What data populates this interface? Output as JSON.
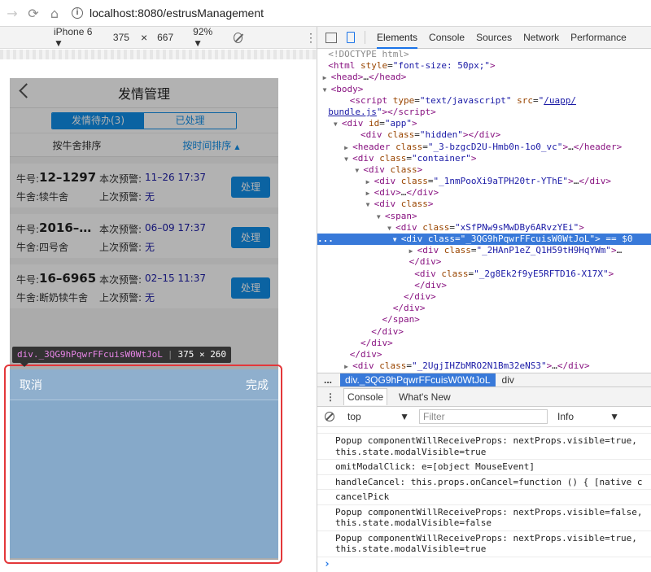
{
  "browser": {
    "url": "localhost:8080/estrusManagement"
  },
  "device_toolbar": {
    "device": "iPhone 6 ▼",
    "width": "375",
    "times": "×",
    "height": "667",
    "zoom": "92% ▼"
  },
  "app": {
    "title": "发情管理",
    "tabs": [
      "发情待办(3)",
      "已处理"
    ],
    "sort_by_shed": "按牛舍排序",
    "sort_by_time": "按时间排序",
    "sort_arrow": "▲",
    "cards": [
      {
        "cow_label": "牛号:",
        "cow_no": "12–1297",
        "shed_label": "牛舍:",
        "shed": "犊牛舍",
        "this_label": "本次预警:",
        "this_time": "11–26 17:37",
        "last_label": "上次预警:",
        "last_time": "无",
        "action": "处理"
      },
      {
        "cow_label": "牛号:",
        "cow_no": "2016–1…",
        "shed_label": "牛舍:",
        "shed": "四号舍",
        "this_label": "本次预警:",
        "this_time": "06–09 17:37",
        "last_label": "上次预警:",
        "last_time": "无",
        "action": "处理"
      },
      {
        "cow_label": "牛号:",
        "cow_no": "16–6965",
        "shed_label": "牛舍:",
        "shed": "断奶犊牛舍",
        "this_label": "本次预警:",
        "this_time": "02–15 11:37",
        "last_label": "上次预警:",
        "last_time": "无",
        "action": "处理"
      }
    ],
    "popup": {
      "cancel": "取消",
      "done": "完成"
    }
  },
  "tooltip": {
    "tag": "div",
    "cls": "._3QG9hPqwrFFcuisW0WtJoL",
    "size": "375 × 260"
  },
  "devtools": {
    "tabs": [
      "Elements",
      "Console",
      "Sources",
      "Network",
      "Performance"
    ],
    "active_tab": "Elements",
    "breadcrumb": {
      "dots": "...",
      "selected": "div._3QG9hPqwrFFcuisW0WtJoL",
      "next": "div"
    },
    "console_tabs": [
      "Console",
      "What's New"
    ],
    "context": "top",
    "filter_placeholder": "Filter",
    "level": "Info",
    "messages": [
      "Popup componentWillReceiveProps: nextProps.visible=true,\nthis.state.modalVisible=true",
      "omitModalClick: e=[object MouseEvent]",
      "handleCancel: this.props.onCancel=function () { [native c",
      "cancelPick",
      "Popup componentWillReceiveProps: nextProps.visible=false,\nthis.state.modalVisible=false",
      "Popup componentWillReceiveProps: nextProps.visible=true,\nthis.state.modalVisible=true"
    ],
    "prompt": "›"
  },
  "colors": {
    "accent": "#108ee9",
    "highlight": "#6fa8dc",
    "red_outline": "#e3373a",
    "selected_row": "#3879d9"
  }
}
